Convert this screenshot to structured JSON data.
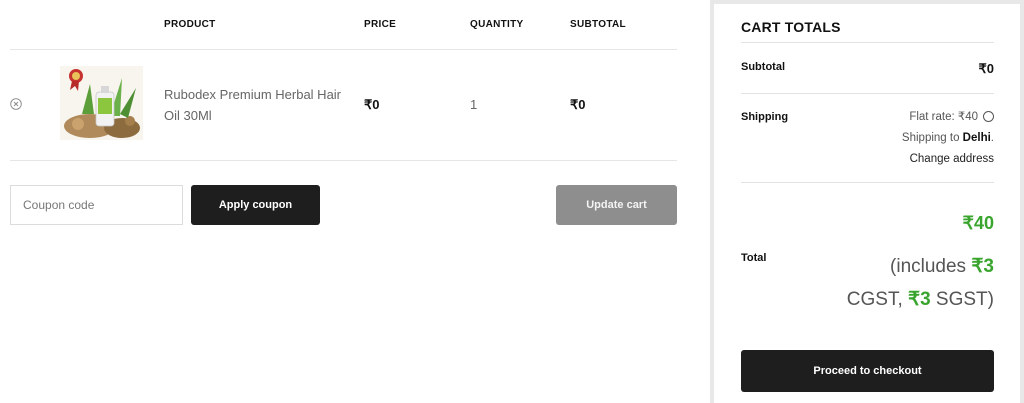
{
  "cart": {
    "headers": {
      "product": "PRODUCT",
      "price": "PRICE",
      "quantity": "QUANTITY",
      "subtotal": "SUBTOTAL"
    },
    "items": [
      {
        "name": "Rubodex Premium Herbal Hair Oil 30Ml",
        "price": "₹0",
        "quantity": "1",
        "subtotal": "₹0"
      }
    ]
  },
  "coupon": {
    "placeholder": "Coupon code",
    "apply_label": "Apply coupon"
  },
  "update_label": "Update cart",
  "totals": {
    "title": "CART TOTALS",
    "subtotal_label": "Subtotal",
    "subtotal_value": "₹0",
    "shipping_label": "Shipping",
    "shipping_rate": "Flat rate: ₹40",
    "shipping_to_prefix": "Shipping to ",
    "shipping_city": "Delhi",
    "shipping_to_suffix": ".",
    "change_address": "Change address",
    "total_label": "Total",
    "total_value": "₹40",
    "tax_open": "(includes ",
    "cgst_value": "₹3",
    "cgst_label": " CGST, ",
    "sgst_value": "₹3",
    "sgst_label": " SGST)"
  },
  "checkout_label": "Proceed to checkout",
  "colors": {
    "accent_green": "#3aa52e",
    "button_dark": "#1e1e1e",
    "button_disabled": "#8e8e8e"
  },
  "icons": [
    "remove-icon",
    "radio-icon",
    "product-image"
  ]
}
